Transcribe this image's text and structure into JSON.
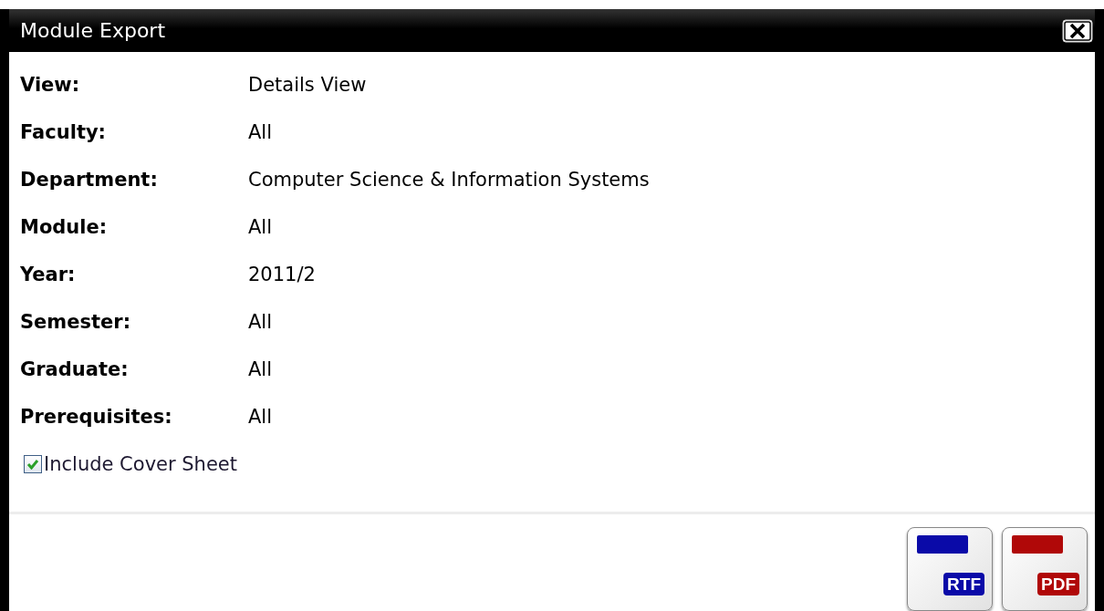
{
  "window": {
    "title": "Module Export"
  },
  "fields": [
    {
      "label": "View:",
      "value": "Details View"
    },
    {
      "label": "Faculty:",
      "value": "All"
    },
    {
      "label": "Department:",
      "value": "Computer Science & Information Systems"
    },
    {
      "label": "Module:",
      "value": "All"
    },
    {
      "label": "Year:",
      "value": "2011/2"
    },
    {
      "label": "Semester:",
      "value": "All"
    },
    {
      "label": "Graduate:",
      "value": "All"
    },
    {
      "label": "Prerequisites:",
      "value": "All"
    }
  ],
  "cover_sheet": {
    "label": "Include Cover Sheet",
    "checked": true
  },
  "export_buttons": [
    {
      "label": "RTF",
      "color": "#0a0aa8"
    },
    {
      "label": "PDF",
      "color": "#b00808"
    }
  ]
}
